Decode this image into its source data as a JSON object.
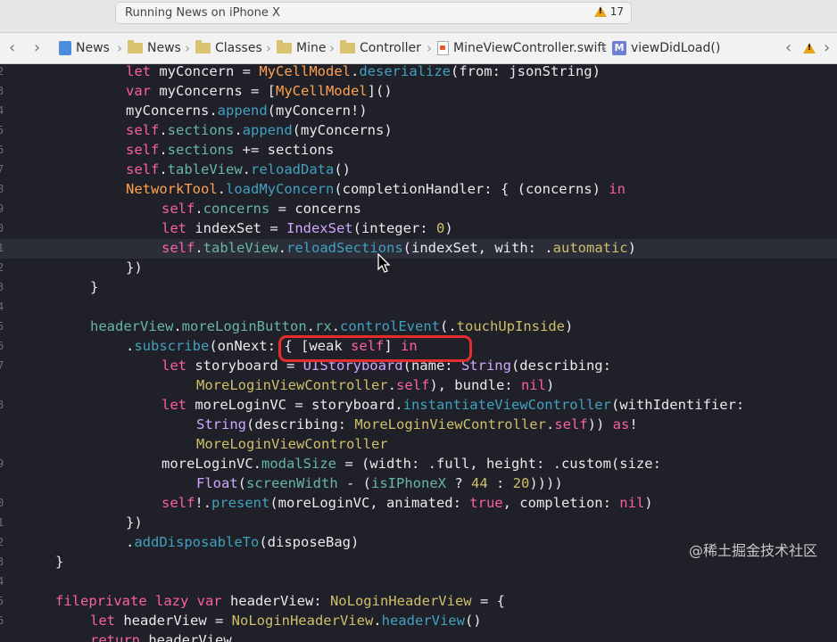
{
  "activity": {
    "text": "Running News on iPhone X",
    "warning_count": "17"
  },
  "breadcrumbs": [
    "News",
    "News",
    "Classes",
    "Mine",
    "Controller",
    "MineViewController.swift",
    "viewDidLoad()"
  ],
  "gutter": [
    "2",
    "3",
    "4",
    "5",
    "6",
    "7",
    "8",
    "9",
    "0",
    "1",
    "2",
    "3",
    "4",
    "5",
    "6",
    "7",
    "",
    "8",
    "",
    "",
    "9",
    "",
    "0",
    "1",
    "2",
    "3",
    "4",
    "5",
    "6"
  ],
  "code": [
    [
      [
        "let",
        "kw"
      ],
      [
        " myConcern = ",
        ""
      ],
      [
        "MyCellModel",
        "cls"
      ],
      [
        ".",
        ""
      ],
      [
        "deserialize",
        "fn"
      ],
      [
        "(from: jsonString)",
        ""
      ]
    ],
    [
      [
        "var",
        "kw"
      ],
      [
        " myConcerns = [",
        ""
      ],
      [
        "MyCellModel",
        "cls"
      ],
      [
        "]()",
        ""
      ]
    ],
    [
      [
        "myConcerns.",
        ""
      ],
      [
        "append",
        "fn"
      ],
      [
        "(myConcern!)",
        ""
      ]
    ],
    [
      [
        "self",
        "kw"
      ],
      [
        ".",
        ""
      ],
      [
        "sections",
        "pr"
      ],
      [
        ".",
        ""
      ],
      [
        "append",
        "fn"
      ],
      [
        "(myConcerns)",
        ""
      ]
    ],
    [
      [
        "self",
        "kw"
      ],
      [
        ".",
        ""
      ],
      [
        "sections",
        "pr"
      ],
      [
        " += sections",
        ""
      ]
    ],
    [
      [
        "self",
        "kw"
      ],
      [
        ".",
        ""
      ],
      [
        "tableView",
        "pr"
      ],
      [
        ".",
        ""
      ],
      [
        "reloadData",
        "fn"
      ],
      [
        "()",
        ""
      ]
    ],
    [
      [
        "NetworkTool",
        "cls"
      ],
      [
        ".",
        ""
      ],
      [
        "loadMyConcern",
        "fn"
      ],
      [
        "(completionHandler: { (concerns) ",
        ""
      ],
      [
        "in",
        "kw"
      ]
    ],
    [
      [
        "self",
        "kw"
      ],
      [
        ".",
        ""
      ],
      [
        "concerns",
        "pr"
      ],
      [
        " = concerns",
        ""
      ]
    ],
    [
      [
        "let",
        "kw"
      ],
      [
        " indexSet = ",
        ""
      ],
      [
        "IndexSet",
        "ty"
      ],
      [
        "(integer: ",
        ""
      ],
      [
        "0",
        "num"
      ],
      [
        ")",
        ""
      ]
    ],
    [
      [
        "self",
        "kw"
      ],
      [
        ".",
        ""
      ],
      [
        "tableView",
        "pr"
      ],
      [
        ".",
        ""
      ],
      [
        "reloadSections",
        "fn"
      ],
      [
        "(indexSet, with: .",
        ""
      ],
      [
        "automatic",
        "enum"
      ],
      [
        ")",
        ""
      ]
    ],
    [
      [
        "})",
        ""
      ]
    ],
    [
      [
        "}",
        ""
      ]
    ],
    [],
    [
      [
        "headerView",
        "pr"
      ],
      [
        ".",
        ""
      ],
      [
        "moreLoginButton",
        "pr"
      ],
      [
        ".",
        ""
      ],
      [
        "rx",
        "pr"
      ],
      [
        ".",
        ""
      ],
      [
        "controlEvent",
        "fn"
      ],
      [
        "(.",
        ""
      ],
      [
        "touchUpInside",
        "enum"
      ],
      [
        ")",
        ""
      ]
    ],
    [
      [
        ".",
        ""
      ],
      [
        "subscribe",
        "fn"
      ],
      [
        "(onNext: { [weak ",
        ""
      ],
      [
        "self",
        "kw"
      ],
      [
        "] ",
        ""
      ],
      [
        "in",
        "kw"
      ]
    ],
    [
      [
        "let",
        "kw"
      ],
      [
        " storyboard = ",
        ""
      ],
      [
        "UIStoryboard",
        "ty"
      ],
      [
        "(name: ",
        ""
      ],
      [
        "String",
        "ty"
      ],
      [
        "(describing:",
        ""
      ]
    ],
    [
      [
        "MoreLoginViewController",
        "tyx"
      ],
      [
        ".",
        ""
      ],
      [
        "self",
        "kw"
      ],
      [
        "), bundle: ",
        ""
      ],
      [
        "nil",
        "kw"
      ],
      [
        ")",
        ""
      ]
    ],
    [
      [
        "let",
        "kw"
      ],
      [
        " moreLoginVC = storyboard.",
        ""
      ],
      [
        "instantiateViewController",
        "fn"
      ],
      [
        "(withIdentifier:",
        ""
      ]
    ],
    [
      [
        "String",
        "ty"
      ],
      [
        "(describing: ",
        ""
      ],
      [
        "MoreLoginViewController",
        "tyx"
      ],
      [
        ".",
        ""
      ],
      [
        "self",
        "kw"
      ],
      [
        ")) ",
        ""
      ],
      [
        "as",
        "kw"
      ],
      [
        "!",
        ""
      ]
    ],
    [
      [
        "MoreLoginViewController",
        "tyx"
      ]
    ],
    [
      [
        "moreLoginVC.",
        ""
      ],
      [
        "modalSize",
        "pr"
      ],
      [
        " = (width: .full, height: .custom(size:",
        ""
      ]
    ],
    [
      [
        "Float",
        "ty"
      ],
      [
        "(",
        ""
      ],
      [
        "screenWidth",
        "pr"
      ],
      [
        " - (",
        ""
      ],
      [
        "isIPhoneX",
        "pr"
      ],
      [
        " ? ",
        ""
      ],
      [
        "44",
        "num"
      ],
      [
        " : ",
        ""
      ],
      [
        "20",
        "num"
      ],
      [
        "))))",
        ""
      ]
    ],
    [
      [
        "self",
        "kw"
      ],
      [
        "!.",
        ""
      ],
      [
        "present",
        "fn"
      ],
      [
        "(moreLoginVC, animated: ",
        ""
      ],
      [
        "true",
        "kw"
      ],
      [
        ", completion: ",
        ""
      ],
      [
        "nil",
        "kw"
      ],
      [
        ")",
        ""
      ]
    ],
    [
      [
        "})",
        ""
      ]
    ],
    [
      [
        ".",
        ""
      ],
      [
        "addDisposableTo",
        "fn"
      ],
      [
        "(disposeBag)",
        ""
      ]
    ],
    [
      [
        "}",
        ""
      ]
    ],
    [],
    [
      [
        "fileprivate lazy var",
        "kw"
      ],
      [
        " headerView: ",
        ""
      ],
      [
        "NoLoginHeaderView",
        "tyx"
      ],
      [
        " = {",
        ""
      ]
    ],
    [
      [
        "let",
        "kw"
      ],
      [
        " headerView = ",
        ""
      ],
      [
        "NoLoginHeaderView",
        "tyx"
      ],
      [
        ".",
        ""
      ],
      [
        "headerView",
        "fn"
      ],
      [
        "()",
        ""
      ]
    ],
    [
      [
        "return",
        "kw"
      ],
      [
        " headerView",
        ""
      ]
    ]
  ],
  "watermark": "@稀土掘金技术社区"
}
